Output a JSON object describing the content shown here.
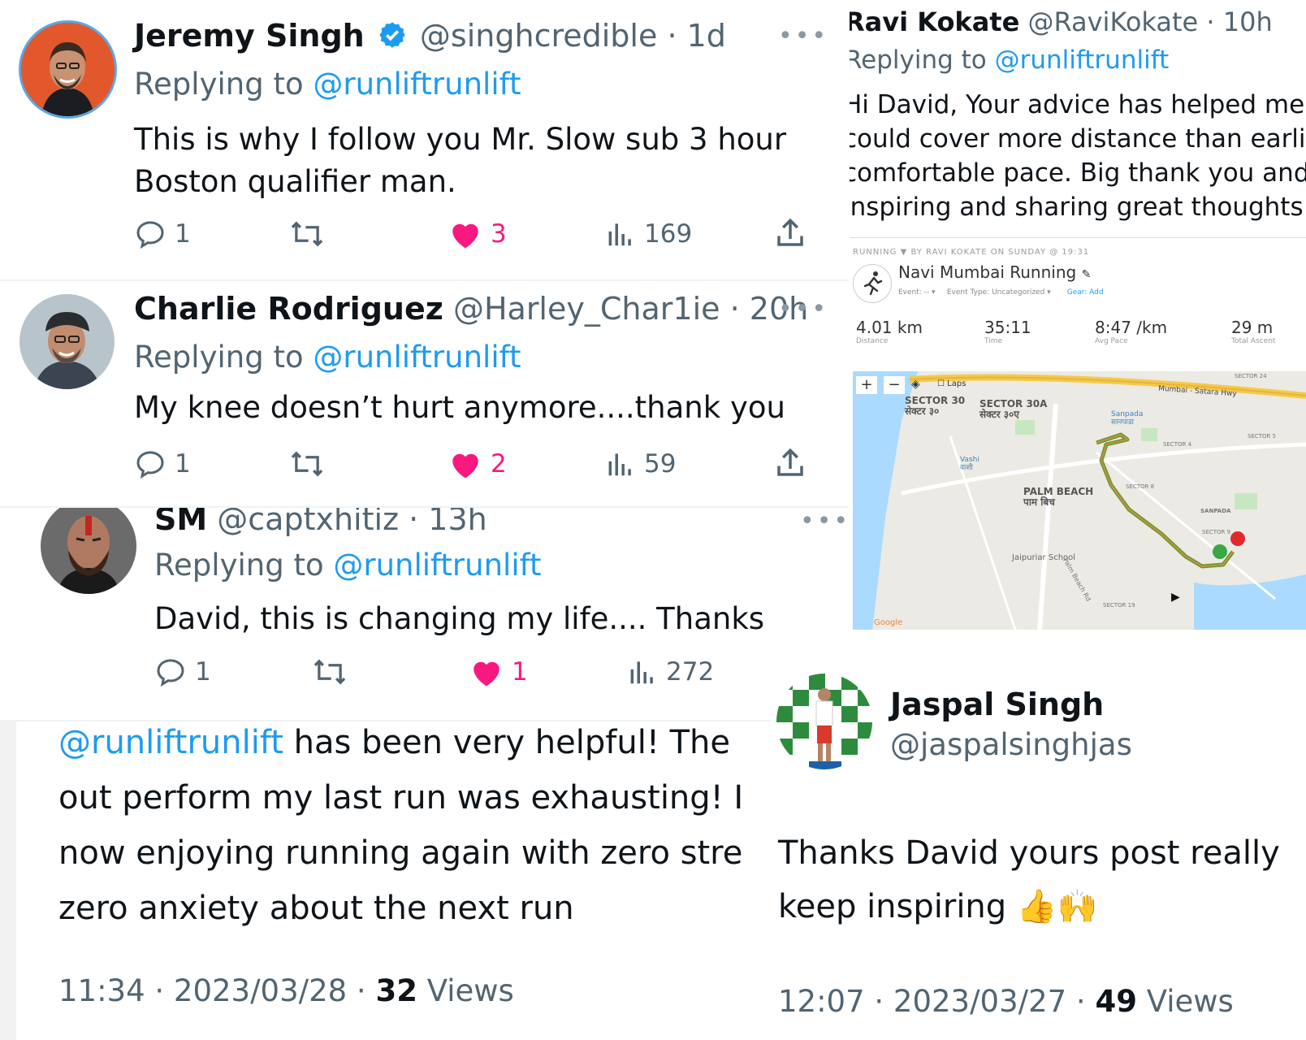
{
  "tweets": [
    {
      "name": "Jeremy Singh",
      "handle": "@singhcredible",
      "time": "· 1d",
      "replying": "Replying to",
      "reply_handle": "@runliftrunlift",
      "text_lines": [
        "This is why I follow you Mr. Slow sub 3 hour",
        "Boston qualifier man."
      ],
      "replies": "1",
      "likes": "3",
      "views": "169"
    },
    {
      "name": "Charlie Rodriguez",
      "handle": "@Harley_Char1ie",
      "time": "· 20h",
      "replying": "Replying to",
      "reply_handle": "@runliftrunlift",
      "text_lines": [
        "My knee doesn’t hurt anymore....thank you"
      ],
      "replies": "1",
      "likes": "2",
      "views": "59"
    },
    {
      "name": "SM",
      "handle": "@captxhitiz",
      "time": "· 13h",
      "replying": "Replying to",
      "reply_handle": "@runliftrunlift",
      "text_lines": [
        "David, this is changing my life.... Thanks"
      ],
      "replies": "1",
      "likes": "1",
      "views": "272"
    }
  ],
  "ravi": {
    "name": "Ravi Kokate",
    "handle": "@RaviKokate",
    "time": "· 10h",
    "replying": "Replying to",
    "reply_handle": "@runliftrunlift",
    "text_lines": [
      "Hi David, Your advice has helped me",
      "could cover more distance than earlier",
      "comfortable pace. Big thank you and",
      "inspiring and sharing great thoughts"
    ],
    "strava": {
      "header": "RUNNING ▼ BY RAVI KOKATE ON SUNDAY @ 19:31",
      "activity_title": "Navi Mumbai Running",
      "meta": [
        "Event: -- ▾",
        "Event Type: Uncategorized ▾",
        "Gear: Add"
      ],
      "stats": [
        {
          "value": "4.01 km",
          "label": "Distance"
        },
        {
          "value": "35:11",
          "label": "Time"
        },
        {
          "value": "8:47 /km",
          "label": "Avg Pace"
        },
        {
          "value": "29 m",
          "label": "Total Ascent"
        }
      ],
      "map_labels": {
        "laps": "Laps",
        "sector30": "SECTOR 30",
        "sector30_hi": "सेक्टर ३०",
        "sector30a": "SECTOR 30A",
        "sector30a_hi": "सेक्टर ३०ए",
        "highway": "Mumbai - Satara Hwy",
        "sector24": "SECTOR 24",
        "sanpada": "Sanpada",
        "sanpada_hi": "सानपाडा",
        "vashi": "Vashi",
        "vashi_hi": "वाशी",
        "palm_beach": "PALM BEACH",
        "palm_beach_hi": "पाम बिच",
        "palm_beach_rd": "Palm Beach Rd",
        "sector4": "SECTOR 4",
        "sector5": "SECTOR 5",
        "sector8": "SECTOR 8",
        "sector9": "SECTOR 9",
        "sector19": "SECTOR 19",
        "sanpada_area": "SANPADA",
        "school": "Jaipuriar School",
        "google": "Google"
      }
    }
  },
  "quote_left": {
    "mention": "@runliftrunlift",
    "lines": [
      "has been very helpful! The",
      "out perform my last run was exhausting! I",
      "now enjoying running again with zero stre",
      "zero anxiety about the next run"
    ],
    "time": "11:34 · 2023/03/28 ·",
    "views_count": "32",
    "views_label": "Views"
  },
  "jaspal": {
    "name": "Jaspal Singh",
    "handle": "@jaspalsinghjas",
    "lines": [
      "Thanks David yours post really",
      "keep inspiring"
    ],
    "emoji": "👍🙌",
    "time": "12:07 · 2023/03/27 ·",
    "views_count": "49",
    "views_label": "Views"
  },
  "colors": {
    "like": "#f91880",
    "link": "#1d9bf0",
    "muted": "#536471",
    "verified": "#1d9bf0",
    "route": "#6a9a3a"
  },
  "icons": [
    "verified-badge-icon",
    "reply-icon",
    "retweet-icon",
    "heart-icon",
    "views-icon",
    "share-icon",
    "more-icon",
    "running-icon"
  ]
}
